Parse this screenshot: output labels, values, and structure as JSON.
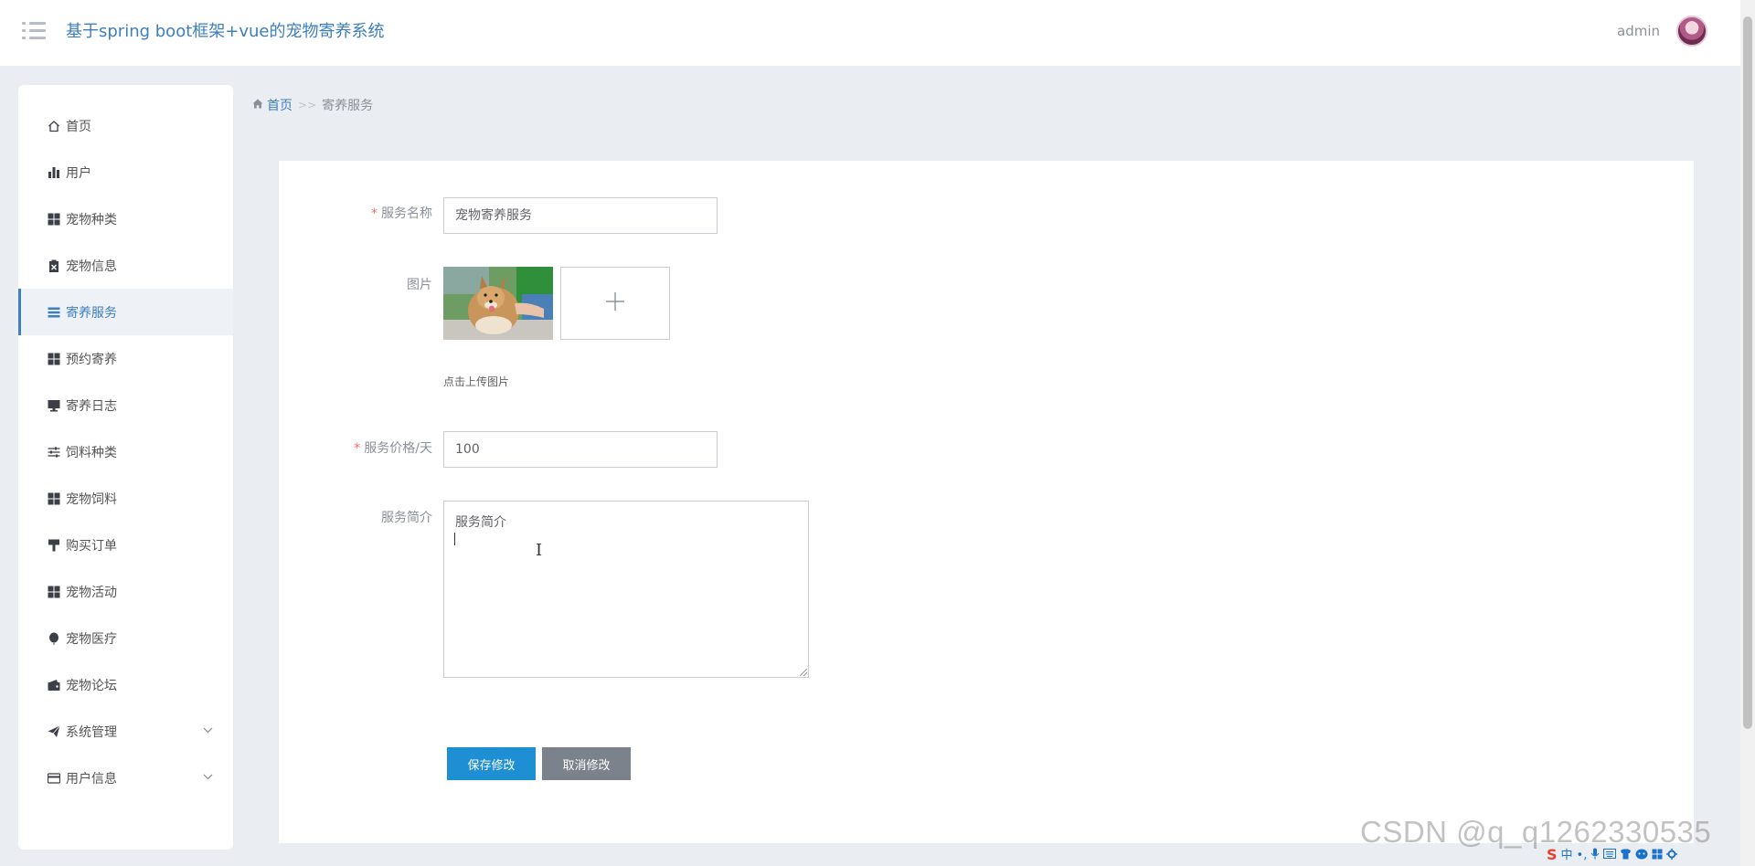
{
  "header": {
    "app_title": "基于spring boot框架+vue的宠物寄养系统",
    "user_name": "admin"
  },
  "sidebar": {
    "items": [
      {
        "label": "首页",
        "icon": "home-icon"
      },
      {
        "label": "用户",
        "icon": "bar-chart-icon"
      },
      {
        "label": "宠物种类",
        "icon": "grid-icon"
      },
      {
        "label": "宠物信息",
        "icon": "clipboard-icon"
      },
      {
        "label": "寄养服务",
        "icon": "list-icon",
        "active": true
      },
      {
        "label": "预约寄养",
        "icon": "grid-icon"
      },
      {
        "label": "寄养日志",
        "icon": "monitor-icon"
      },
      {
        "label": "饲料种类",
        "icon": "sliders-icon"
      },
      {
        "label": "宠物饲料",
        "icon": "grid-icon"
      },
      {
        "label": "购买订单",
        "icon": "brush-icon"
      },
      {
        "label": "宠物活动",
        "icon": "grid-icon"
      },
      {
        "label": "宠物医疗",
        "icon": "balloon-icon"
      },
      {
        "label": "宠物论坛",
        "icon": "wallet-icon"
      },
      {
        "label": "系统管理",
        "icon": "paper-plane-icon",
        "expandable": true
      },
      {
        "label": "用户信息",
        "icon": "card-icon",
        "expandable": true
      }
    ]
  },
  "breadcrumb": {
    "home": "首页",
    "separator": ">>",
    "current": "寄养服务"
  },
  "form": {
    "service_name_label": "服务名称",
    "service_name_value": "宠物寄养服务",
    "image_label": "图片",
    "upload_hint": "点击上传图片",
    "price_label": "服务价格/天",
    "price_value": "100",
    "intro_label": "服务简介",
    "intro_value": "服务简介",
    "save_button": "保存修改",
    "cancel_button": "取消修改"
  },
  "watermark": "CSDN @q_q1262330535",
  "ime_tray": {
    "logo": "S",
    "mode": "中"
  },
  "colors": {
    "accent": "#3d7fbd",
    "save_button": "#1f8fd4",
    "cancel_button": "#7b828c",
    "required": "#f56c6c",
    "background": "#eaedf1"
  }
}
